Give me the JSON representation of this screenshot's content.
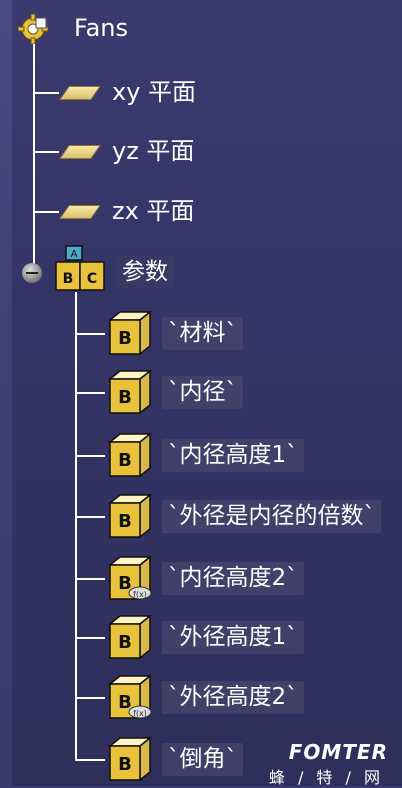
{
  "tree": {
    "root": {
      "label": "Fans",
      "icon": "part-gear-icon"
    },
    "planes": [
      {
        "label": "xy 平面",
        "icon": "plane-icon"
      },
      {
        "label": "yz 平面",
        "icon": "plane-icon"
      },
      {
        "label": "zx 平面",
        "icon": "plane-icon"
      }
    ],
    "parameters": {
      "label": "参数",
      "icon": "parameters-set-icon",
      "items": [
        {
          "label": "`材料`",
          "icon": "parameter-icon"
        },
        {
          "label": "`内径`",
          "icon": "parameter-icon"
        },
        {
          "label": "`内径高度1`",
          "icon": "parameter-icon"
        },
        {
          "label": "`外径是内径的倍数`",
          "icon": "parameter-icon"
        },
        {
          "label": "`内径高度2`",
          "icon": "parameter-formula-icon"
        },
        {
          "label": "`外径高度1`",
          "icon": "parameter-icon"
        },
        {
          "label": "`外径高度2`",
          "icon": "parameter-formula-icon"
        },
        {
          "label": "`倒角`",
          "icon": "parameter-icon"
        }
      ]
    }
  },
  "watermark": {
    "logo": "FOMTER",
    "sub": "蜂 / 特 / 网"
  },
  "colors": {
    "background": "#35356a",
    "text": "#ffffff",
    "label_box": "#46466e",
    "plane_fill": "#e8d48a"
  }
}
